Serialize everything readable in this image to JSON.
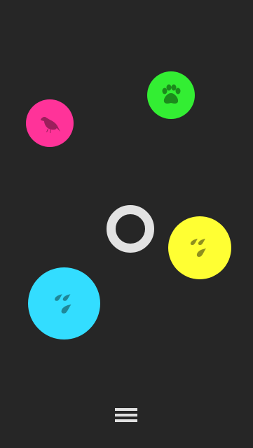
{
  "screen": {
    "background_color": "#262626"
  },
  "bubbles": [
    {
      "name": "bird",
      "icon": "bird-icon",
      "color": "#ff3399",
      "icon_color": "#9b1f5c"
    },
    {
      "name": "paw",
      "icon": "paw-icon",
      "color": "#33ee33",
      "icon_color": "#1c8a1c"
    },
    {
      "name": "rain-yellow",
      "icon": "raindrops-icon",
      "color": "#ffff33",
      "icon_color": "#8f8f1e"
    },
    {
      "name": "rain-cyan",
      "icon": "raindrops-icon",
      "color": "#33ddff",
      "icon_color": "#1f8799"
    }
  ],
  "center_control": {
    "icon": "ring-icon",
    "color": "#e2e2e2"
  },
  "menu": {
    "icon": "hamburger-menu-icon",
    "color": "#e0e0e0"
  }
}
